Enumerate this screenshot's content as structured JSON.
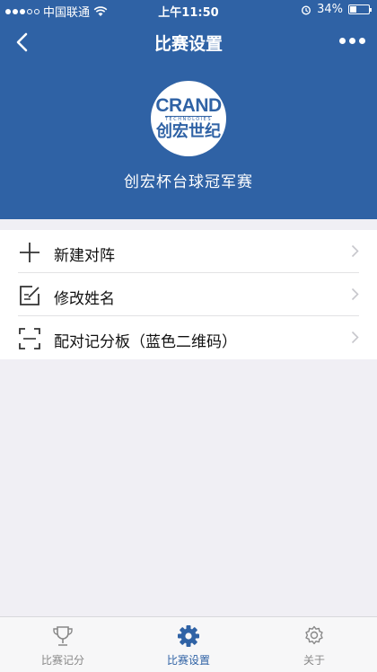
{
  "statusbar": {
    "carrier": "中国联通",
    "time": "上午11:50",
    "battery": "34%",
    "battery_level": 0.34
  },
  "navbar": {
    "title": "比赛设置"
  },
  "logo": {
    "main": "CRAND",
    "sub": "TECHNOLOIES",
    "cn": "创宏世纪"
  },
  "event_name": "创宏杯台球冠军赛",
  "menu": [
    {
      "label": "新建对阵",
      "icon": "plus-icon"
    },
    {
      "label": "修改姓名",
      "icon": "edit-icon"
    },
    {
      "label": "配对记分板（蓝色二维码）",
      "icon": "scan-icon"
    }
  ],
  "tabs": [
    {
      "label": "比赛记分",
      "icon": "trophy-icon",
      "active": false
    },
    {
      "label": "比赛设置",
      "icon": "gear-icon",
      "active": true
    },
    {
      "label": "关于",
      "icon": "settings-outline-icon",
      "active": false
    }
  ],
  "colors": {
    "primary": "#2f62a5",
    "background": "#f0eff4",
    "inactive": "#888888"
  }
}
